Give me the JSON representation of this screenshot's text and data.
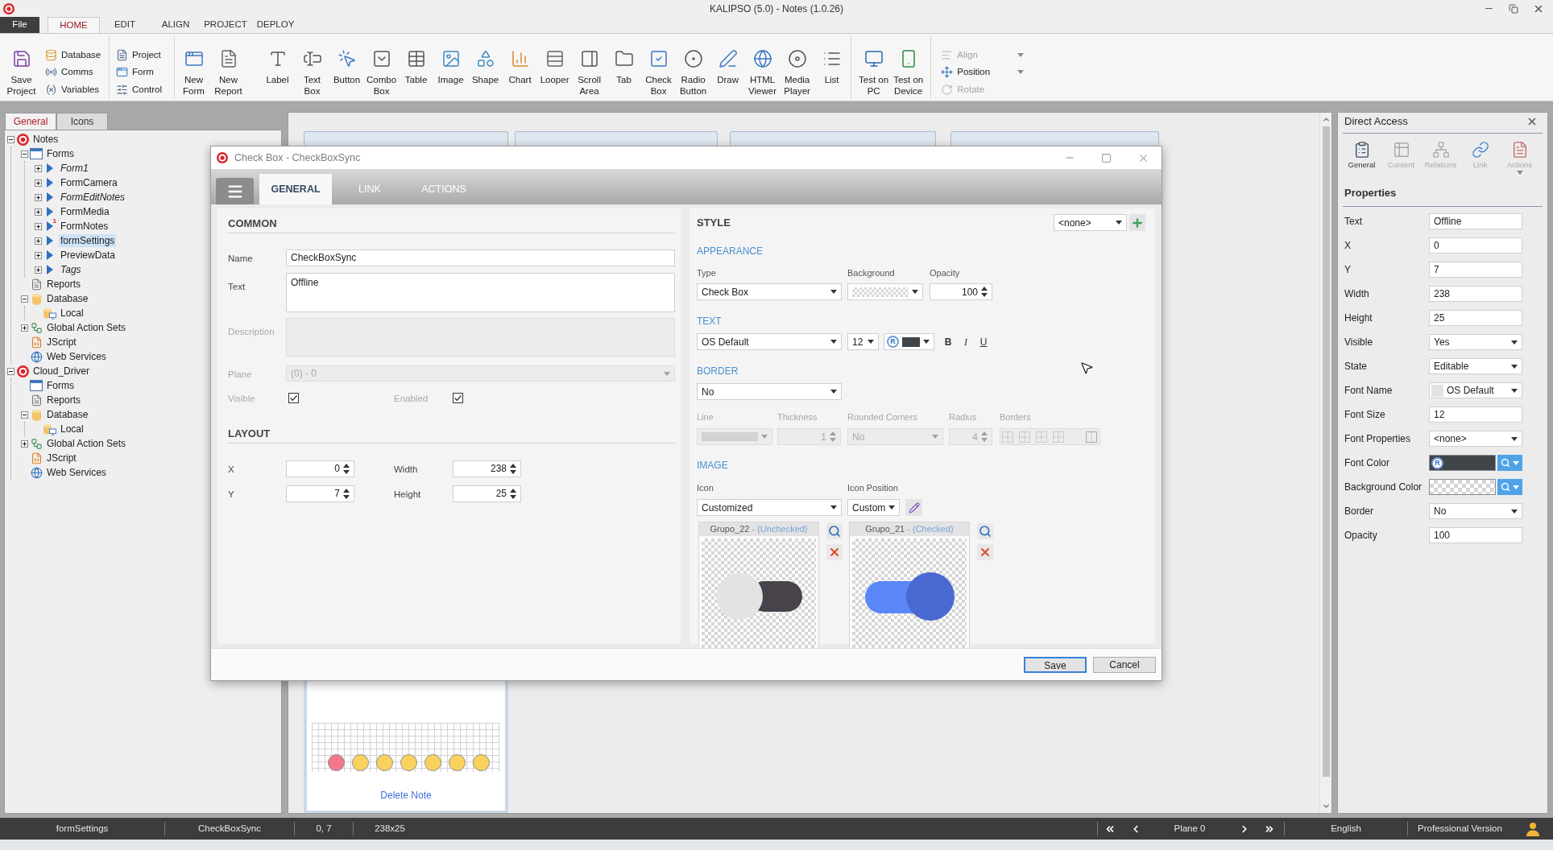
{
  "window": {
    "title": "KALIPSO (5.0) - Notes (1.0.26)"
  },
  "file_button": "File",
  "menu_tabs": [
    {
      "label": "HOME",
      "selected": true
    },
    {
      "label": "EDIT",
      "selected": false
    },
    {
      "label": "ALIGN",
      "selected": false
    },
    {
      "label": "PROJECT",
      "selected": false
    },
    {
      "label": "DEPLOY",
      "selected": false
    }
  ],
  "ribbon": [
    {
      "kind": "large",
      "items": [
        {
          "label": "Save\nProject"
        }
      ]
    },
    {
      "kind": "stack",
      "items": [
        {
          "label": "Database"
        },
        {
          "label": "Comms"
        },
        {
          "label": "Variables"
        }
      ]
    },
    {
      "kind": "stack",
      "items": [
        {
          "label": "Project"
        },
        {
          "label": "Form"
        },
        {
          "label": "Control"
        }
      ]
    },
    {
      "kind": "large",
      "items": [
        {
          "label": "New\nForm"
        },
        {
          "label": "New\nReport"
        },
        {
          "label": "Label"
        },
        {
          "label": "Text\nBox"
        },
        {
          "label": "Button"
        },
        {
          "label": "Combo\nBox"
        },
        {
          "label": "Table"
        },
        {
          "label": "Image"
        },
        {
          "label": "Shape"
        },
        {
          "label": "Chart"
        },
        {
          "label": "Looper"
        },
        {
          "label": "Scroll\nArea"
        },
        {
          "label": "Tab"
        },
        {
          "label": "Check\nBox"
        },
        {
          "label": "Radio\nButton"
        },
        {
          "label": "Draw"
        },
        {
          "label": "HTML\nViewer"
        },
        {
          "label": "Media\nPlayer"
        },
        {
          "label": "List"
        }
      ]
    },
    {
      "kind": "large",
      "items": [
        {
          "label": "Test on\nPC"
        },
        {
          "label": "Test on\nDevice"
        }
      ]
    },
    {
      "kind": "stack",
      "items": [
        {
          "label": "Align",
          "disabled": true,
          "dropdown": true
        },
        {
          "label": "Position",
          "disabled": false,
          "dropdown": true
        },
        {
          "label": "Rotate",
          "disabled": true,
          "dropdown": false
        }
      ]
    }
  ],
  "left_panel": {
    "tabs": [
      {
        "label": "General",
        "selected": true
      },
      {
        "label": "Icons",
        "selected": false
      }
    ],
    "tree": [
      {
        "label": "Notes",
        "kind": "project",
        "expanded": true,
        "selected": false,
        "children": [
          {
            "label": "Forms",
            "kind": "forms",
            "expanded": true,
            "selected": false,
            "children": [
              {
                "label": "Form1",
                "kind": "form",
                "expanded": false,
                "italic": true,
                "selected": false
              },
              {
                "label": "FormCamera",
                "kind": "form",
                "expanded": false,
                "italic": false,
                "selected": false
              },
              {
                "label": "FormEditNotes",
                "kind": "form",
                "expanded": false,
                "italic": true,
                "selected": false
              },
              {
                "label": "FormMedia",
                "kind": "form",
                "expanded": false,
                "italic": false,
                "selected": false
              },
              {
                "label": "FormNotes",
                "kind": "form",
                "expanded": false,
                "italic": false,
                "selected": false,
                "badge": "1"
              },
              {
                "label": "formSettings",
                "kind": "form",
                "expanded": false,
                "italic": false,
                "selected": true
              },
              {
                "label": "PreviewData",
                "kind": "form",
                "expanded": false,
                "italic": false,
                "selected": false
              },
              {
                "label": "Tags",
                "kind": "form",
                "expanded": false,
                "italic": true,
                "selected": false
              }
            ]
          },
          {
            "label": "Reports",
            "kind": "reports",
            "selected": false
          },
          {
            "label": "Database",
            "kind": "database",
            "expanded": true,
            "selected": false,
            "children": [
              {
                "label": "Local",
                "kind": "local",
                "selected": false
              }
            ]
          },
          {
            "label": "Global Action Sets",
            "kind": "actions",
            "expanded": false,
            "selected": false
          },
          {
            "label": "JScript",
            "kind": "script",
            "selected": false
          },
          {
            "label": "Web Services",
            "kind": "services",
            "selected": false
          }
        ]
      },
      {
        "label": "Cloud_Driver",
        "kind": "project",
        "expanded": true,
        "selected": false,
        "children": [
          {
            "label": "Forms",
            "kind": "forms",
            "selected": false
          },
          {
            "label": "Reports",
            "kind": "reports",
            "selected": false
          },
          {
            "label": "Database",
            "kind": "database",
            "expanded": true,
            "selected": false,
            "children": [
              {
                "label": "Local",
                "kind": "local",
                "selected": false
              }
            ]
          },
          {
            "label": "Global Action Sets",
            "kind": "actions",
            "expanded": false,
            "selected": false
          },
          {
            "label": "JScript",
            "kind": "script",
            "selected": false
          },
          {
            "label": "Web Services",
            "kind": "services",
            "selected": false
          }
        ]
      }
    ]
  },
  "canvas": {
    "form_preview": {
      "dots": [
        {
          "color": "#f2778f"
        },
        {
          "color": "#fbd15e"
        },
        {
          "color": "#fbd15e"
        },
        {
          "color": "#fbd15e"
        },
        {
          "color": "#fbd15e"
        },
        {
          "color": "#fbd15e"
        },
        {
          "color": "#fbd15e"
        }
      ],
      "link": "Delete Note"
    }
  },
  "dialog": {
    "title": "Check Box - CheckBoxSync",
    "tabs": [
      {
        "label": "GENERAL",
        "selected": true
      },
      {
        "label": "LINK",
        "selected": false
      },
      {
        "label": "ACTIONS",
        "selected": false
      }
    ],
    "common": {
      "heading": "COMMON",
      "name": {
        "label": "Name",
        "value": "CheckBoxSync",
        "disabled": false
      },
      "text": {
        "label": "Text",
        "value": "Offline",
        "disabled": false
      },
      "description": {
        "label": "Description",
        "disabled": true
      },
      "plane": {
        "label": "Plane",
        "value": "(0) - 0",
        "disabled": true
      },
      "visible": {
        "label": "Visible",
        "checked": true
      },
      "enabled": {
        "label": "Enabled",
        "checked": true
      }
    },
    "layout": {
      "heading": "LAYOUT",
      "fields": [
        {
          "label": "X",
          "value": "0"
        },
        {
          "label": "Width",
          "value": "238"
        },
        {
          "label": "Y",
          "value": "7"
        },
        {
          "label": "Height",
          "value": "25"
        }
      ]
    },
    "style": {
      "heading": "STYLE",
      "preset": "<none>",
      "appearance": {
        "heading": "APPEARANCE",
        "type": {
          "label": "Type",
          "value": "Check Box"
        },
        "background": {
          "label": "Background"
        },
        "opacity": {
          "label": "Opacity",
          "value": "100"
        }
      },
      "text": {
        "heading": "TEXT",
        "font": "OS Default",
        "size": "12",
        "color_badge": "R",
        "format": [
          "B",
          "I",
          "U"
        ]
      },
      "border": {
        "heading": "BORDER",
        "value": "No",
        "disabled": true,
        "line": {
          "label": "Line"
        },
        "thickness": {
          "label": "Thickness",
          "value": "1"
        },
        "rounded": {
          "label": "Rounded Corners",
          "value": "No"
        },
        "radius": {
          "label": "Radius",
          "value": "4"
        },
        "borders": {
          "label": "Borders"
        }
      },
      "image": {
        "heading": "IMAGE",
        "icon": {
          "label": "Icon",
          "value": "Customized"
        },
        "position": {
          "label": "Icon Position",
          "value": "Custom"
        },
        "previews": [
          {
            "name": "Grupo_22",
            "caption": "- (Unchecked)",
            "checked": false
          },
          {
            "name": "Grupo_21",
            "caption": "- (Checked)",
            "checked": true
          }
        ]
      }
    },
    "buttons": [
      {
        "label": "Save",
        "default": true
      },
      {
        "label": "Cancel",
        "default": false
      }
    ]
  },
  "direct_access": {
    "title": "Direct Access",
    "tools": [
      {
        "label": "General",
        "selected": true,
        "dropdown": false
      },
      {
        "label": "Content",
        "selected": false,
        "dropdown": false
      },
      {
        "label": "Relations",
        "selected": false,
        "dropdown": false
      },
      {
        "label": "Link",
        "selected": false,
        "dropdown": false
      },
      {
        "label": "Actions",
        "selected": false,
        "dropdown": true
      }
    ],
    "heading": "Properties",
    "properties": [
      {
        "label": "Text",
        "kind": "input",
        "value": "Offline"
      },
      {
        "label": "X",
        "kind": "input",
        "value": "0"
      },
      {
        "label": "Y",
        "kind": "input",
        "value": "7"
      },
      {
        "label": "Width",
        "kind": "input",
        "value": "238"
      },
      {
        "label": "Height",
        "kind": "input",
        "value": "25"
      },
      {
        "label": "Visible",
        "kind": "select",
        "value": "Yes"
      },
      {
        "label": "State",
        "kind": "select",
        "value": "Editable"
      },
      {
        "label": "Font Name",
        "kind": "font",
        "value": "OS Default"
      },
      {
        "label": "Font Size",
        "kind": "input",
        "value": "12"
      },
      {
        "label": "Font Properties",
        "kind": "select",
        "value": "<none>"
      },
      {
        "label": "Font Color",
        "kind": "color",
        "badge": "R"
      },
      {
        "label": "Background Color",
        "kind": "transparent"
      },
      {
        "label": "Border",
        "kind": "select",
        "value": "No"
      },
      {
        "label": "Opacity",
        "kind": "input",
        "value": "100"
      }
    ]
  },
  "status_bar": {
    "cells": [
      "formSettings",
      "CheckBoxSync",
      "0, 7",
      "238x25"
    ],
    "plane": "Plane 0",
    "language": "English",
    "edition": "Professional Version"
  }
}
